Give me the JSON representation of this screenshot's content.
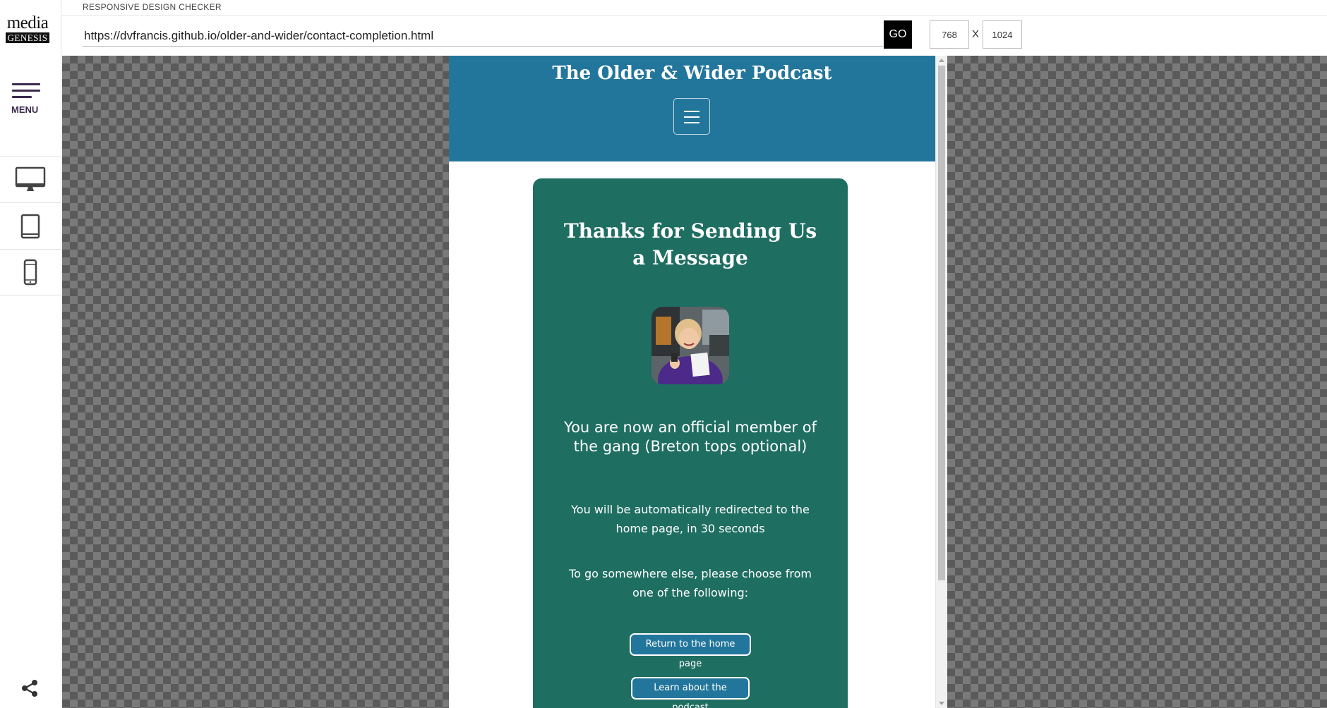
{
  "app": {
    "title": "RESPONSIVE DESIGN CHECKER",
    "logo_line1": "media",
    "logo_line2": "GENESIS"
  },
  "sidebar": {
    "menu_label": "MENU",
    "devices": [
      {
        "name": "desktop",
        "icon": "desktop-monitor-icon"
      },
      {
        "name": "tablet",
        "icon": "tablet-icon"
      },
      {
        "name": "mobile",
        "icon": "mobile-phone-icon"
      }
    ],
    "share_icon": "share-icon"
  },
  "toolbar": {
    "url": "https://dvfrancis.github.io/older-and-wider/contact-completion.html",
    "go_label": "GO",
    "width": "768",
    "separator": "X",
    "height": "1024"
  },
  "site": {
    "title": "The Older & Wider Podcast",
    "header_color": "#23769b",
    "card_color": "#1f6e62",
    "card": {
      "heading": "Thanks for Sending Us a Message",
      "member_text": "You are now an official member of the gang (Breton tops optional)",
      "redirect_text": "You will be automatically redirected to the home page, in 30 seconds",
      "choose_text": "To go somewhere else, please choose from one of the following:",
      "buttons": [
        {
          "label": "Return to the home page"
        },
        {
          "label": "Learn about the podcast"
        }
      ]
    }
  }
}
